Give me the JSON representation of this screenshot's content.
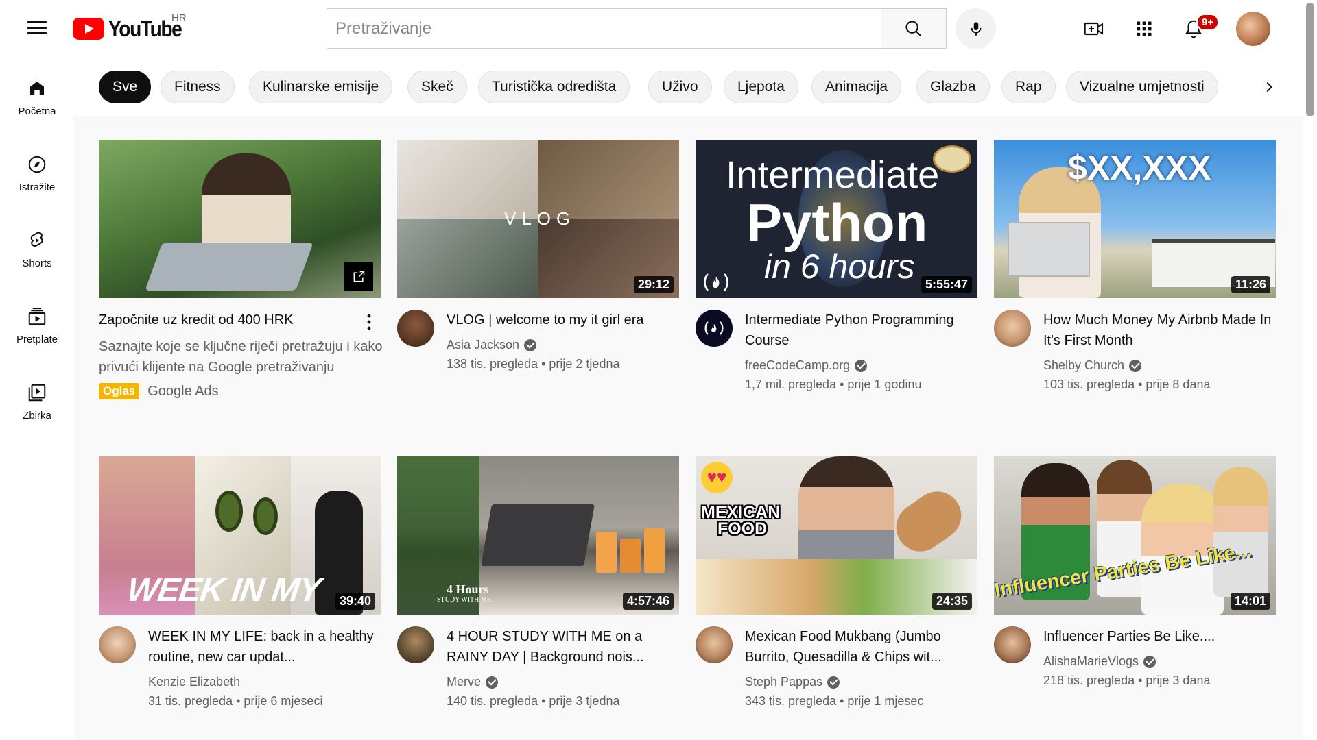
{
  "header": {
    "logo_text": "YouTube",
    "country": "HR",
    "search_placeholder": "Pretraživanje",
    "notifications_badge": "9+"
  },
  "sidebar": {
    "items": [
      {
        "label": "Početna",
        "icon": "home-icon"
      },
      {
        "label": "Istražite",
        "icon": "compass-icon"
      },
      {
        "label": "Shorts",
        "icon": "shorts-icon"
      },
      {
        "label": "Pretplate",
        "icon": "subscriptions-icon"
      },
      {
        "label": "Zbirka",
        "icon": "library-icon"
      }
    ]
  },
  "chips": [
    "Sve",
    "Fitness",
    "Kulinarske emisije",
    "Skeč",
    "Turistička odredišta",
    "Uživo",
    "Ljepota",
    "Animacija",
    "Glazba",
    "Rap",
    "Vizualne umjetnosti"
  ],
  "ad": {
    "title": "Započnite uz kredit od 400 HRK",
    "description": "Saznajte koje se ključne riječi pretražuju i kako privući klijente na Google pretraživanju",
    "badge": "Oglas",
    "advertiser": "Google Ads"
  },
  "videos": [
    {
      "title": "VLOG | welcome to my it girl era",
      "channel": "Asia Jackson",
      "verified": true,
      "views": "138 tis. pregleda",
      "age": "prije 2 tjedna",
      "duration": "29:12",
      "thumb_text": "VLOG"
    },
    {
      "title": "Intermediate Python Programming Course",
      "channel": "freeCodeCamp.org",
      "verified": true,
      "views": "1,7 mil. pregleda",
      "age": "prije 1 godinu",
      "duration": "5:55:47",
      "thumb_text": [
        "Intermediate",
        "Python",
        "in 6 hours"
      ]
    },
    {
      "title": "How Much Money My Airbnb Made In It's First Month",
      "channel": "Shelby Church",
      "verified": true,
      "views": "103 tis. pregleda",
      "age": "prije 8 dana",
      "duration": "11:26",
      "thumb_text": "$XX,XXX"
    },
    {
      "title": "WEEK IN MY LIFE: back in a healthy routine, new car updat...",
      "channel": "Kenzie Elizabeth",
      "verified": false,
      "views": "31 tis. pregleda",
      "age": "prije 6 mjeseci",
      "duration": "39:40",
      "thumb_text": "WEEK IN MY LIFE"
    },
    {
      "title": "4 HOUR STUDY WITH ME on a RAINY DAY | Background nois...",
      "channel": "Merve",
      "verified": true,
      "views": "140 tis. pregleda",
      "age": "prije 3 tjedna",
      "duration": "4:57:46",
      "thumb_text": [
        "4 Hours",
        "STUDY WITH ME"
      ]
    },
    {
      "title": "Mexican Food Mukbang (Jumbo Burrito, Quesadilla & Chips wit...",
      "channel": "Steph Pappas",
      "verified": true,
      "views": "343 tis. pregleda",
      "age": "prije 1 mjesec",
      "duration": "24:35",
      "thumb_text": [
        "MEXICAN",
        "FOOD"
      ]
    },
    {
      "title": "Influencer Parties Be Like....",
      "channel": "AlishaMarieVlogs",
      "verified": true,
      "views": "218 tis. pregleda",
      "age": "prije 3 dana",
      "duration": "14:01",
      "thumb_text": "Influencer Parties Be Like..."
    }
  ],
  "colors": {
    "brand_red": "#ff0000",
    "ad_badge": "#f5b400",
    "notification": "#cc0000"
  }
}
